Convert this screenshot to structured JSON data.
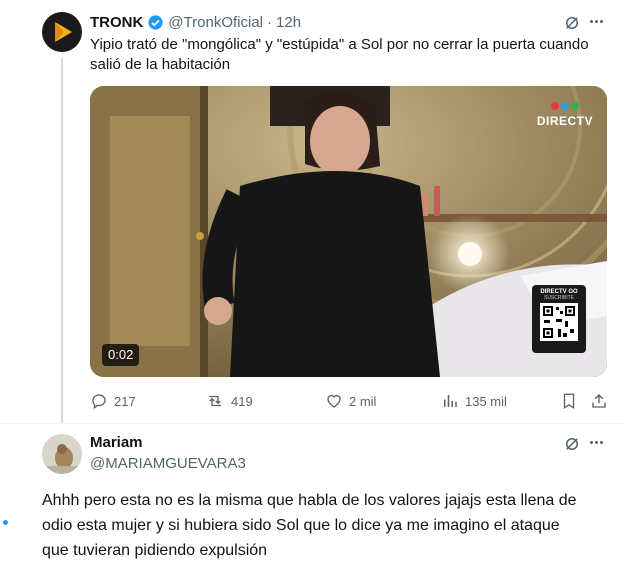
{
  "tweet": {
    "author_name": "TRONK",
    "handle": "@TronkOficial",
    "separator": "·",
    "time": "12h",
    "text": "Yipio trató de \"mongólica\" y \"estúpida\" a Sol por no cerrar la puerta cuando salió de la habitación",
    "video": {
      "duration": "0:02",
      "channel_logo": "DIRECTV",
      "qr_header": "DIRECTV GO",
      "qr_caption": "SUSCRIBITE"
    },
    "stats": {
      "replies": "217",
      "reposts": "419",
      "likes": "2 mil",
      "views": "135 mil"
    }
  },
  "reply": {
    "author_name": "Mariam",
    "handle": "@MARIAMGUEVARA3",
    "text": "Ahhh pero esta no es la misma que habla de los valores jajajs esta llena de odio esta mujer y si hubiera sido Sol que lo dice ya me imagino el ataque que tuvieran pidiendo expulsión"
  },
  "colors": {
    "accent": "#1d9bf0",
    "text": "#0f1419",
    "muted": "#536471",
    "thread_line": "#cfd9de",
    "verified": "#1d9bf0"
  },
  "icons": [
    "verified-badge-icon",
    "grok-icon",
    "more-icon",
    "reply-icon",
    "repost-icon",
    "like-icon",
    "views-icon",
    "bookmark-icon",
    "share-icon"
  ]
}
